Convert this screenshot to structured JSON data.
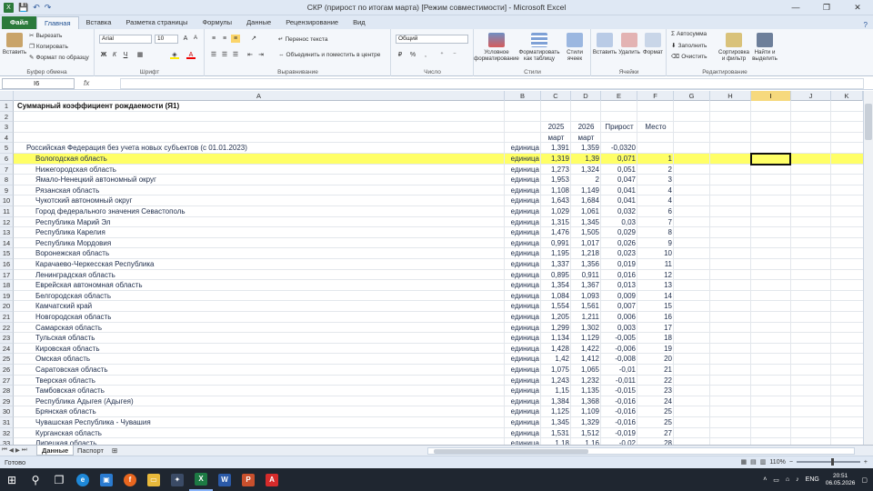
{
  "titlebar": {
    "title": "СКР (прирост по итогам марта)  [Режим совместимости] - Microsoft Excel",
    "qat": {
      "save": "💾",
      "undo": "↶",
      "redo": "↷"
    },
    "controls": {
      "help": "?",
      "minimize": "—",
      "restore": "❐",
      "close": "✕"
    }
  },
  "ribbon_tabs": [
    "Файл",
    "Главная",
    "Вставка",
    "Разметка страницы",
    "Формулы",
    "Данные",
    "Рецензирование",
    "Вид"
  ],
  "ribbon": {
    "clipboard": {
      "paste": "Вставить",
      "cut": "Вырезать",
      "copy": "Копировать",
      "format_painter": "Формат по образцу",
      "label": "Буфер обмена"
    },
    "font": {
      "name": "Arial",
      "size": "10",
      "bold": "Ж",
      "italic": "К",
      "underline": "Ч",
      "label": "Шрифт"
    },
    "alignment": {
      "wrap": "Перенос текста",
      "merge": "Объединить и поместить в центре",
      "label": "Выравнивание"
    },
    "number": {
      "format": "Общий",
      "label": "Число"
    },
    "styles": {
      "conditional": "Условное форматирование",
      "as_table": "Форматировать как таблицу",
      "cell_styles": "Стили ячеек",
      "label": "Стили"
    },
    "cells": {
      "insert": "Вставить",
      "delete": "Удалить",
      "format": "Формат",
      "label": "Ячейки"
    },
    "editing": {
      "autosum": "Автосумма",
      "fill": "Заполнить",
      "clear": "Очистить",
      "sort": "Сортировка и фильтр",
      "find": "Найти и выделить",
      "label": "Редактирование"
    }
  },
  "formula_bar": {
    "name_box": "I6",
    "fx": "fx",
    "content": ""
  },
  "columns": [
    "A",
    "B",
    "C",
    "D",
    "E",
    "F",
    "G",
    "H",
    "I",
    "J",
    "K"
  ],
  "selected_column": "I",
  "rows": [
    {
      "n": "1",
      "a": "Суммарный коэффициент рождаемости (Я1)",
      "bold": true
    },
    {
      "n": "2"
    },
    {
      "n": "3",
      "c": "2025",
      "d": "2026",
      "e": "Прирост",
      "f": "Место"
    },
    {
      "n": "4",
      "c": "март",
      "d": "март"
    },
    {
      "n": "5",
      "a": "Российская Федерация без учета новых субъектов (с 01.01.2023)",
      "b": "единица",
      "c": "1,391",
      "d": "1,359",
      "e": "-0,0320",
      "indent": 1
    },
    {
      "n": "6",
      "a": "Вологодская область",
      "b": "единица",
      "c": "1,319",
      "d": "1,39",
      "e": "0,071",
      "f": "1",
      "hl": true
    },
    {
      "n": "7",
      "a": "Нижегородская область",
      "b": "единица",
      "c": "1,273",
      "d": "1,324",
      "e": "0,051",
      "f": "2"
    },
    {
      "n": "8",
      "a": "Ямало-Ненецкий автономный округ",
      "b": "единица",
      "c": "1,953",
      "d": "2",
      "e": "0,047",
      "f": "3"
    },
    {
      "n": "9",
      "a": "Рязанская область",
      "b": "единица",
      "c": "1,108",
      "d": "1,149",
      "e": "0,041",
      "f": "4"
    },
    {
      "n": "10",
      "a": "Чукотский автономный округ",
      "b": "единица",
      "c": "1,643",
      "d": "1,684",
      "e": "0,041",
      "f": "4"
    },
    {
      "n": "11",
      "a": "Город федерального значения Севастополь",
      "b": "единица",
      "c": "1,029",
      "d": "1,061",
      "e": "0,032",
      "f": "6"
    },
    {
      "n": "12",
      "a": "Республика Марий Эл",
      "b": "единица",
      "c": "1,315",
      "d": "1,345",
      "e": "0,03",
      "f": "7"
    },
    {
      "n": "13",
      "a": "Республика Карелия",
      "b": "единица",
      "c": "1,476",
      "d": "1,505",
      "e": "0,029",
      "f": "8"
    },
    {
      "n": "14",
      "a": "Республика Мордовия",
      "b": "единица",
      "c": "0,991",
      "d": "1,017",
      "e": "0,026",
      "f": "9"
    },
    {
      "n": "15",
      "a": "Воронежская область",
      "b": "единица",
      "c": "1,195",
      "d": "1,218",
      "e": "0,023",
      "f": "10"
    },
    {
      "n": "16",
      "a": "Карачаево-Черкесская Республика",
      "b": "единица",
      "c": "1,337",
      "d": "1,356",
      "e": "0,019",
      "f": "11"
    },
    {
      "n": "17",
      "a": "Ленинградская область",
      "b": "единица",
      "c": "0,895",
      "d": "0,911",
      "e": "0,016",
      "f": "12"
    },
    {
      "n": "18",
      "a": "Еврейская автономная область",
      "b": "единица",
      "c": "1,354",
      "d": "1,367",
      "e": "0,013",
      "f": "13"
    },
    {
      "n": "19",
      "a": "Белгородская область",
      "b": "единица",
      "c": "1,084",
      "d": "1,093",
      "e": "0,009",
      "f": "14"
    },
    {
      "n": "20",
      "a": "Камчатский край",
      "b": "единица",
      "c": "1,554",
      "d": "1,561",
      "e": "0,007",
      "f": "15"
    },
    {
      "n": "21",
      "a": "Новгородская область",
      "b": "единица",
      "c": "1,205",
      "d": "1,211",
      "e": "0,006",
      "f": "16"
    },
    {
      "n": "22",
      "a": "Самарская область",
      "b": "единица",
      "c": "1,299",
      "d": "1,302",
      "e": "0,003",
      "f": "17"
    },
    {
      "n": "23",
      "a": "Тульская область",
      "b": "единица",
      "c": "1,134",
      "d": "1,129",
      "e": "-0,005",
      "f": "18"
    },
    {
      "n": "24",
      "a": "Кировская область",
      "b": "единица",
      "c": "1,428",
      "d": "1,422",
      "e": "-0,006",
      "f": "19"
    },
    {
      "n": "25",
      "a": "Омская область",
      "b": "единица",
      "c": "1,42",
      "d": "1,412",
      "e": "-0,008",
      "f": "20"
    },
    {
      "n": "26",
      "a": "Саратовская область",
      "b": "единица",
      "c": "1,075",
      "d": "1,065",
      "e": "-0,01",
      "f": "21"
    },
    {
      "n": "27",
      "a": "Тверская область",
      "b": "единица",
      "c": "1,243",
      "d": "1,232",
      "e": "-0,011",
      "f": "22"
    },
    {
      "n": "28",
      "a": "Тамбовская область",
      "b": "единица",
      "c": "1,15",
      "d": "1,135",
      "e": "-0,015",
      "f": "23"
    },
    {
      "n": "29",
      "a": "Республика Адыгея (Адыгея)",
      "b": "единица",
      "c": "1,384",
      "d": "1,368",
      "e": "-0,016",
      "f": "24"
    },
    {
      "n": "30",
      "a": "Брянская область",
      "b": "единица",
      "c": "1,125",
      "d": "1,109",
      "e": "-0,016",
      "f": "25"
    },
    {
      "n": "31",
      "a": "Чувашская Республика - Чувашия",
      "b": "единица",
      "c": "1,345",
      "d": "1,329",
      "e": "-0,016",
      "f": "25"
    },
    {
      "n": "32",
      "a": "Курганская область",
      "b": "единица",
      "c": "1,531",
      "d": "1,512",
      "e": "-0,019",
      "f": "27"
    },
    {
      "n": "33",
      "a": "Липецкая область",
      "b": "единица",
      "c": "1,18",
      "d": "1,16",
      "e": "-0,02",
      "f": "28"
    }
  ],
  "sheet_tabs": [
    "Данные",
    "Паспорт"
  ],
  "status": {
    "ready": "Готово",
    "zoom": "110%",
    "zoom_minus": "−",
    "zoom_plus": "+"
  },
  "taskbar": {
    "lang": "ENG",
    "time": "20:51",
    "date": "06.05.2026"
  },
  "colors": {
    "highlight": "#ffff66",
    "excel_green": "#2b7a3b"
  }
}
